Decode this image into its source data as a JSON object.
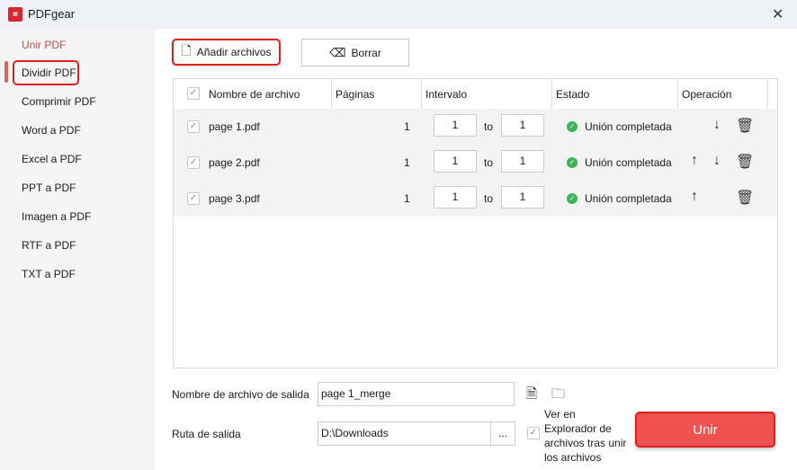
{
  "window": {
    "title": "PDFgear",
    "logo_text": "PDF"
  },
  "sidebar": {
    "items": [
      {
        "label": "Unir PDF"
      },
      {
        "label": "Dividir PDF"
      },
      {
        "label": "Comprimir PDF"
      },
      {
        "label": "Word a PDF"
      },
      {
        "label": "Excel a PDF"
      },
      {
        "label": "PPT a PDF"
      },
      {
        "label": "Imagen a PDF"
      },
      {
        "label": "RTF a PDF"
      },
      {
        "label": "TXT a PDF"
      }
    ]
  },
  "toolbar": {
    "add_label": "Añadir archivos",
    "clear_label": "Borrar"
  },
  "table": {
    "headers": {
      "name": "Nombre de archivo",
      "pages": "Páginas",
      "range": "Intervalo",
      "status": "Estado",
      "operation": "Operación"
    },
    "rows": [
      {
        "name": "page 1.pdf",
        "pages": "1",
        "from": "1",
        "to_label": "to",
        "to": "1",
        "status": "Unión completada",
        "up": false,
        "down": true
      },
      {
        "name": "page 2.pdf",
        "pages": "1",
        "from": "1",
        "to_label": "to",
        "to": "1",
        "status": "Unión completada",
        "up": true,
        "down": true
      },
      {
        "name": "page 3.pdf",
        "pages": "1",
        "from": "1",
        "to_label": "to",
        "to": "1",
        "status": "Unión completada",
        "up": true,
        "down": false
      }
    ]
  },
  "output": {
    "name_label": "Nombre de archivo de salida",
    "name_value": "page 1_merge",
    "path_label": "Ruta de salida",
    "path_value": "D:\\Downloads",
    "browse_label": "...",
    "open_explorer_label": "Ver en Explorador de archivos tras unir los archivos",
    "merge_label": "Unir"
  },
  "colors": {
    "accent": "#ef5350",
    "highlight": "#e02020",
    "success": "#3cb55a"
  }
}
